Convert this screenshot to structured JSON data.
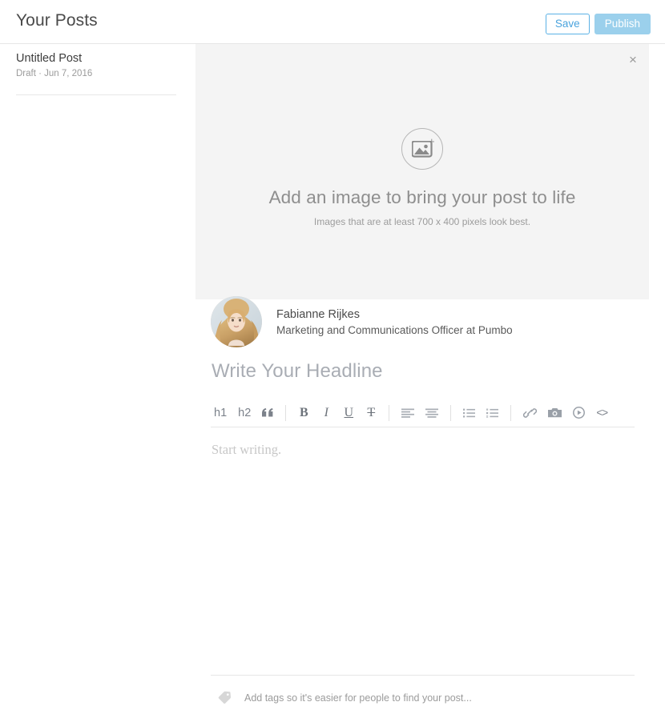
{
  "header": {
    "title": "Your Posts",
    "save_label": "Save",
    "publish_label": "Publish",
    "save_color": "#4aa3dd",
    "publish_bg": "#9bd0ec"
  },
  "sidebar": {
    "posts": [
      {
        "title": "Untitled Post",
        "meta": "Draft · Jun 7, 2016"
      }
    ]
  },
  "hero": {
    "close_label": "×",
    "icon": "add-image-icon",
    "plus": "+",
    "headline": "Add an image to bring your post to life",
    "subtext": "Images that are at least 700 x 400 pixels look best."
  },
  "author": {
    "name": "Fabianne Rijkes",
    "role": "Marketing and Communications Officer at Pumbo"
  },
  "editor": {
    "headline_placeholder": "Write Your Headline",
    "body_placeholder": "Start writing.",
    "toolbar": [
      {
        "name": "heading-1-button",
        "label": "h1",
        "kind": "text"
      },
      {
        "name": "heading-2-button",
        "label": "h2",
        "kind": "text"
      },
      {
        "name": "blockquote-button",
        "label": "“",
        "kind": "quote"
      },
      {
        "name": "toolbar-separator-1",
        "label": "",
        "kind": "sep"
      },
      {
        "name": "bold-button",
        "label": "B",
        "kind": "bold"
      },
      {
        "name": "italic-button",
        "label": "I",
        "kind": "italic"
      },
      {
        "name": "underline-button",
        "label": "U",
        "kind": "underline"
      },
      {
        "name": "strikethrough-button",
        "label": "T",
        "kind": "strike"
      },
      {
        "name": "toolbar-separator-2",
        "label": "",
        "kind": "sep"
      },
      {
        "name": "align-left-button",
        "label": "",
        "kind": "align-left"
      },
      {
        "name": "align-center-button",
        "label": "",
        "kind": "align-center"
      },
      {
        "name": "toolbar-separator-3",
        "label": "",
        "kind": "sep"
      },
      {
        "name": "bulleted-list-button",
        "label": "",
        "kind": "ul"
      },
      {
        "name": "numbered-list-button",
        "label": "",
        "kind": "ol"
      },
      {
        "name": "toolbar-separator-4",
        "label": "",
        "kind": "sep"
      },
      {
        "name": "link-button",
        "label": "",
        "kind": "link"
      },
      {
        "name": "image-button",
        "label": "",
        "kind": "camera"
      },
      {
        "name": "video-button",
        "label": "",
        "kind": "video"
      },
      {
        "name": "code-button",
        "label": "<>",
        "kind": "code"
      }
    ]
  },
  "tags": {
    "icon": "tag-icon",
    "placeholder": "Add tags so it's easier for people to find your post..."
  }
}
